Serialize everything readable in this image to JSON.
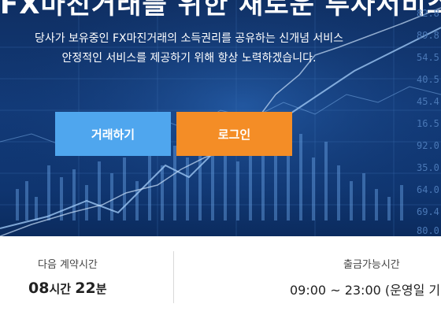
{
  "hero": {
    "headline": "FX마진거래를 위한 새로운 투자서비스",
    "subtitle_line1": "당사가 보유중인 FX마진거래의 소득권리를 공유하는 신개념 서비스",
    "subtitle_line2": "안정적인 서비스를 제공하기 위해 항상 노력하겠습니다.",
    "trade_button": "거래하기",
    "login_button": "로그인",
    "axis_labels": [
      "82.8",
      "89.8",
      "54.5",
      "40.5",
      "45.4",
      "16.5",
      "92.0",
      "35.0",
      "64.0",
      "69.4",
      "80.0"
    ]
  },
  "info": {
    "contract": {
      "label": "다음 계약시간",
      "hours": "08",
      "hours_unit": "시간",
      "minutes": "22",
      "minutes_unit": "분"
    },
    "withdraw": {
      "label": "출금가능시간",
      "value": "09:00 ~ 23:00 (운영일 기"
    }
  },
  "colors": {
    "hero_bg": "#123a78",
    "trade_button": "#4fa6ee",
    "login_button": "#f48d26"
  }
}
